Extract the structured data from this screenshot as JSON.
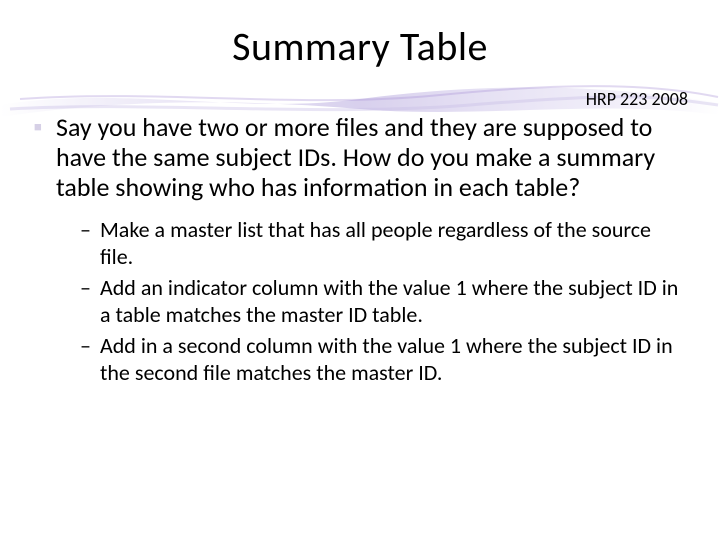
{
  "title": "Summary Table",
  "header_tag": "HRP 223 2008",
  "bullet": {
    "mark": "▪",
    "text": "Say you have two or more files and they are supposed to have the same subject IDs.  How do you make a summary table showing who has information in each table?"
  },
  "sub_mark": "–",
  "sub_items": [
    "Make a master list that has all people regardless of the source file.",
    "Add an indicator column with the value 1 where the subject ID in a table matches the master ID table.",
    "Add in a second column with the value 1 where the subject ID in the second file matches the master ID."
  ]
}
